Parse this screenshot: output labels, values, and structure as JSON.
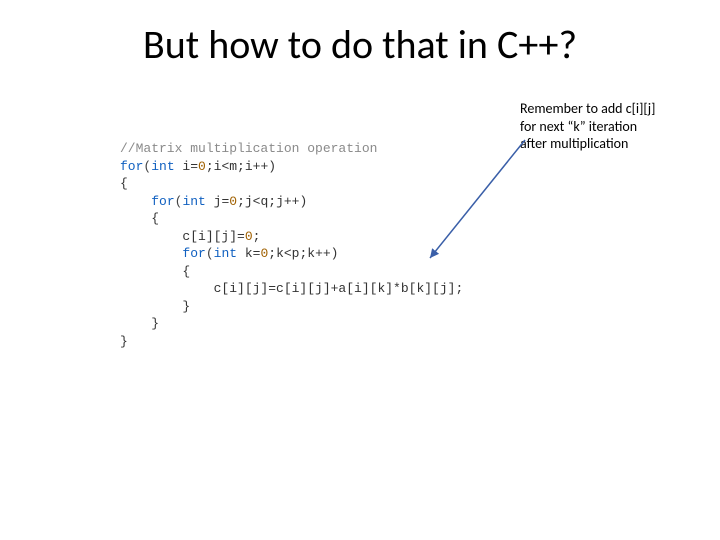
{
  "title": "But how to do that in C++?",
  "annotation": {
    "line1": "Remember to add c[i][j]",
    "line2": "for next “k” iteration",
    "line3": "after multiplication"
  },
  "code": {
    "comment": "//Matrix multiplication operation",
    "l1_for": "for",
    "l1_int": "int",
    "l1_rest_a": "(",
    "l1_rest_b": " i=",
    "l1_zero": "0",
    "l1_rest_c": ";i<m;i++)",
    "l2": "{",
    "l3_indent": "    ",
    "l3_for": "for",
    "l3_int": "int",
    "l3_rest_a": "(",
    "l3_rest_b": " j=",
    "l3_zero": "0",
    "l3_rest_c": ";j<q;j++)",
    "l4": "    {",
    "l5": "        c[i][j]=",
    "l5_zero": "0",
    "l5_semi": ";",
    "l6_indent": "        ",
    "l6_for": "for",
    "l6_int": "int",
    "l6_rest_a": "(",
    "l6_rest_b": " k=",
    "l6_zero": "0",
    "l6_rest_c": ";k<p;k++)",
    "l7": "        {",
    "l8": "            c[i][j]=c[i][j]+a[i][k]*b[k][j];",
    "l9": "        }",
    "l10": "    }",
    "l11": "}"
  }
}
